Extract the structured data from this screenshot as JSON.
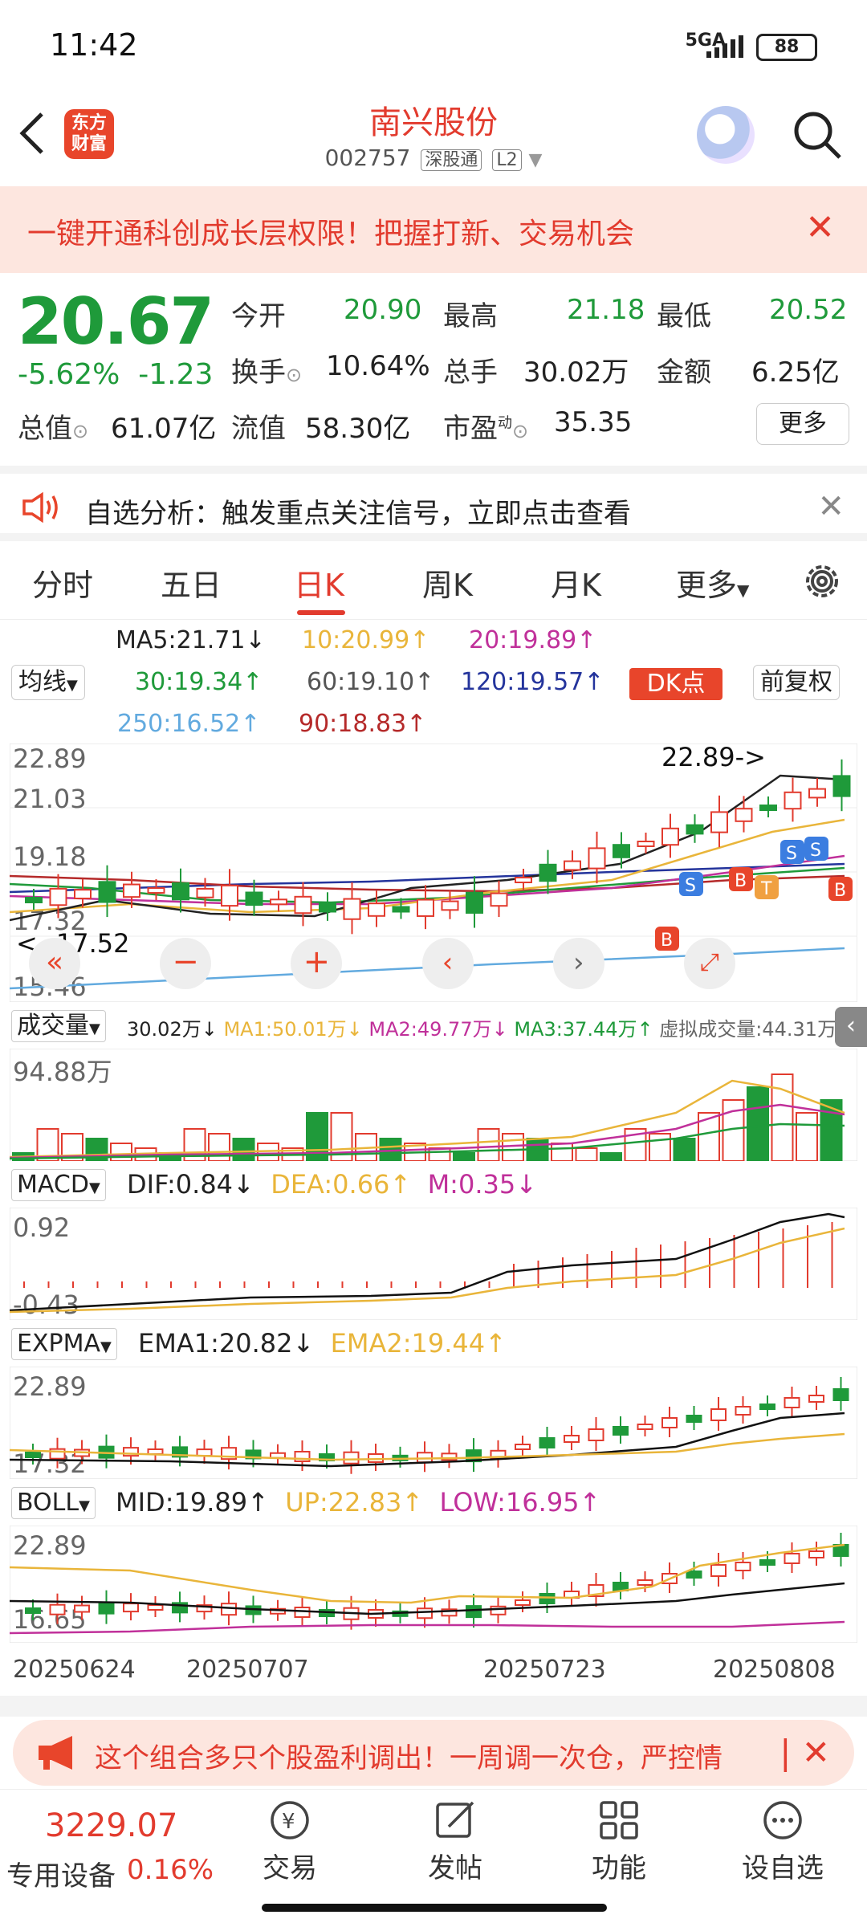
{
  "status": {
    "time": "11:42",
    "network": "5GA",
    "battery": "88"
  },
  "header": {
    "logo_text": "东方财富",
    "stock_name": "南兴股份",
    "stock_code": "002757",
    "tag1": "深股通",
    "tag2": "L2"
  },
  "banner": {
    "text": "一键开通科创成长层权限！把握打新、交易机会"
  },
  "quote": {
    "price": "20.67",
    "change_pct": "-5.62%",
    "change": "-1.23",
    "open_label": "今开",
    "open": "20.90",
    "high_label": "最高",
    "high": "21.18",
    "low_label": "最低",
    "low": "20.52",
    "turnover_label": "换手",
    "turnover": "10.64%",
    "volume_label": "总手",
    "volume": "30.02万",
    "amount_label": "金额",
    "amount": "6.25亿",
    "mktcap_label": "总值",
    "mktcap": "61.07亿",
    "float_label": "流值",
    "float": "58.30亿",
    "pe_label": "市盈",
    "pe_sup": "动",
    "pe": "35.35",
    "more": "更多"
  },
  "notice": {
    "text": "自选分析：触发重点关注信号，立即点击查看"
  },
  "tabs": [
    "分时",
    "五日",
    "日K",
    "周K",
    "月K",
    "更多"
  ],
  "ma": {
    "selector": "均线",
    "ma5": "MA5:21.71↓",
    "ma10": "10:20.99↑",
    "ma20": "20:19.89↑",
    "ma30": "30:19.34↑",
    "ma60": "60:19.10↑",
    "ma120": "120:19.57↑",
    "ma250": "250:16.52↑",
    "ma90": "90:18.83↑",
    "dk": "DK点",
    "adjust": "前复权"
  },
  "kchart": {
    "y_top": "22.89",
    "y_mid1": "21.03",
    "y_mid2": "19.18",
    "y_low": "17.32",
    "y_bottom": "15.46",
    "high_annot": "22.89->",
    "low_annot": "<--17.52"
  },
  "volume": {
    "selector": "成交量",
    "val": "30.02万↓",
    "ma1": "MA1:50.01万↓",
    "ma2": "MA2:49.77万↓",
    "ma3": "MA3:37.44万↑",
    "virtual": "虚拟成交量:44.31万",
    "y_top": "94.88万"
  },
  "macd": {
    "selector": "MACD",
    "dif": "DIF:0.84↓",
    "dea": "DEA:0.66↑",
    "m": "M:0.35↓",
    "y_top": "0.92",
    "y_low": "-0.43"
  },
  "expma": {
    "selector": "EXPMA",
    "ema1": "EMA1:20.82↓",
    "ema2": "EMA2:19.44↑",
    "y_top": "22.89",
    "y_low": "17.32"
  },
  "boll": {
    "selector": "BOLL",
    "mid": "MID:19.89↑",
    "up": "UP:22.83↑",
    "low": "LOW:16.95↑",
    "y_top": "22.89",
    "y_low": "16.65"
  },
  "dates": [
    "20250624",
    "20250707",
    "20250723",
    "20250808"
  ],
  "promo": {
    "text": "这个组合多只个股盈利调出！一周调一次仓，严控情"
  },
  "bottom": {
    "index_value": "3229.07",
    "index_name": "专用设备",
    "index_change": "0.16%",
    "nav": [
      "交易",
      "发帖",
      "功能",
      "设自选"
    ]
  },
  "colors": {
    "up": "#e23b2e",
    "down": "#1f9a3a",
    "accent": "#e8452b"
  }
}
